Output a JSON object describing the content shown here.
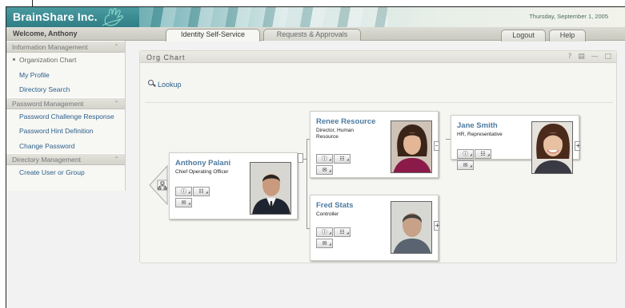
{
  "header": {
    "brand": "BrainShare Inc.",
    "date": "Thursday, September 1, 2005"
  },
  "nav": {
    "welcome": "Welcome, Anthony",
    "tabs": [
      {
        "label": "Identity Self-Service",
        "active": true
      },
      {
        "label": "Requests & Approvals",
        "active": false
      }
    ],
    "logout": "Logout",
    "help": "Help"
  },
  "sidebar": {
    "sections": [
      {
        "title": "Information Management",
        "items": [
          "Organization Chart",
          "My Profile",
          "Directory Search"
        ]
      },
      {
        "title": "Password Management",
        "items": [
          "Password Challenge Response",
          "Password Hint Definition",
          "Change Password"
        ]
      },
      {
        "title": "Directory Management",
        "items": [
          "Create User or Group"
        ]
      }
    ]
  },
  "panel": {
    "title": "Org Chart",
    "tools": [
      "?",
      "print",
      "minimize",
      "maximize"
    ],
    "lookup": "Lookup"
  },
  "org": {
    "root": {
      "name": "Anthony Palani",
      "title": "Chief Operating Officer"
    },
    "reports": [
      {
        "name": "Renee Resource",
        "title": "Director, Human Resource"
      },
      {
        "name": "Fred Stats",
        "title": "Controller"
      }
    ],
    "second_level": {
      "name": "Jane Smith",
      "title": "HR, Representative"
    },
    "action_icons": [
      "info-icon",
      "org-icon",
      "email-icon"
    ]
  },
  "colors": {
    "brand": "#2f7e86",
    "link": "#2c5f8a",
    "name": "#4d7aa0"
  }
}
